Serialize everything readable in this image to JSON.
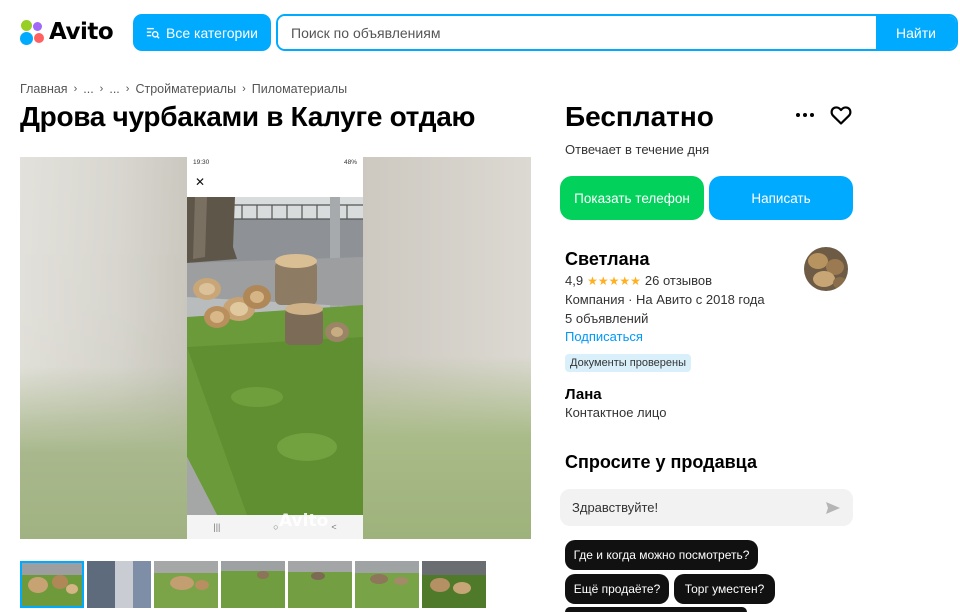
{
  "header": {
    "logo_text": "Avito",
    "categories_label": "Все категории",
    "search_placeholder": "Поиск по объявлениям",
    "search_button": "Найти"
  },
  "breadcrumb": [
    "Главная",
    "...",
    "...",
    "Стройматериалы",
    "Пиломатериалы"
  ],
  "listing": {
    "title": "Дрова чурбаками в Калуге отдаю",
    "price": "Бесплатно",
    "reply_time": "Отвечает в течение дня",
    "photo_watermark": "Avito",
    "phone_status_time": "19:30",
    "phone_status_battery": "48%",
    "thumbnail_count": 7,
    "active_thumbnail": 1
  },
  "actions": {
    "show_phone": "Показать телефон",
    "write": "Написать"
  },
  "seller": {
    "name": "Светлана",
    "rating": "4,9",
    "stars": "★★★★★",
    "reviews": "26 отзывов",
    "type": "Компания · На Авито с 2018 года",
    "ads": "5 объявлений",
    "subscribe": "Подписаться",
    "verified_badge": "Документы проверены"
  },
  "contact": {
    "name": "Лана",
    "role": "Контактное лицо"
  },
  "ask": {
    "title": "Спросите у продавца",
    "message": "Здравствуйте!",
    "quick_questions": [
      "Где и когда можно посмотреть?",
      "Ещё продаёте?",
      "Торг уместен?"
    ]
  },
  "colors": {
    "accent": "#00aaff",
    "green_button": "#02d15c",
    "star": "#ffb021",
    "link": "#0099f7"
  },
  "icons": [
    "avito-logo-icon",
    "categories-search-icon",
    "more-dots-icon",
    "heart-icon",
    "send-icon",
    "close-icon"
  ]
}
